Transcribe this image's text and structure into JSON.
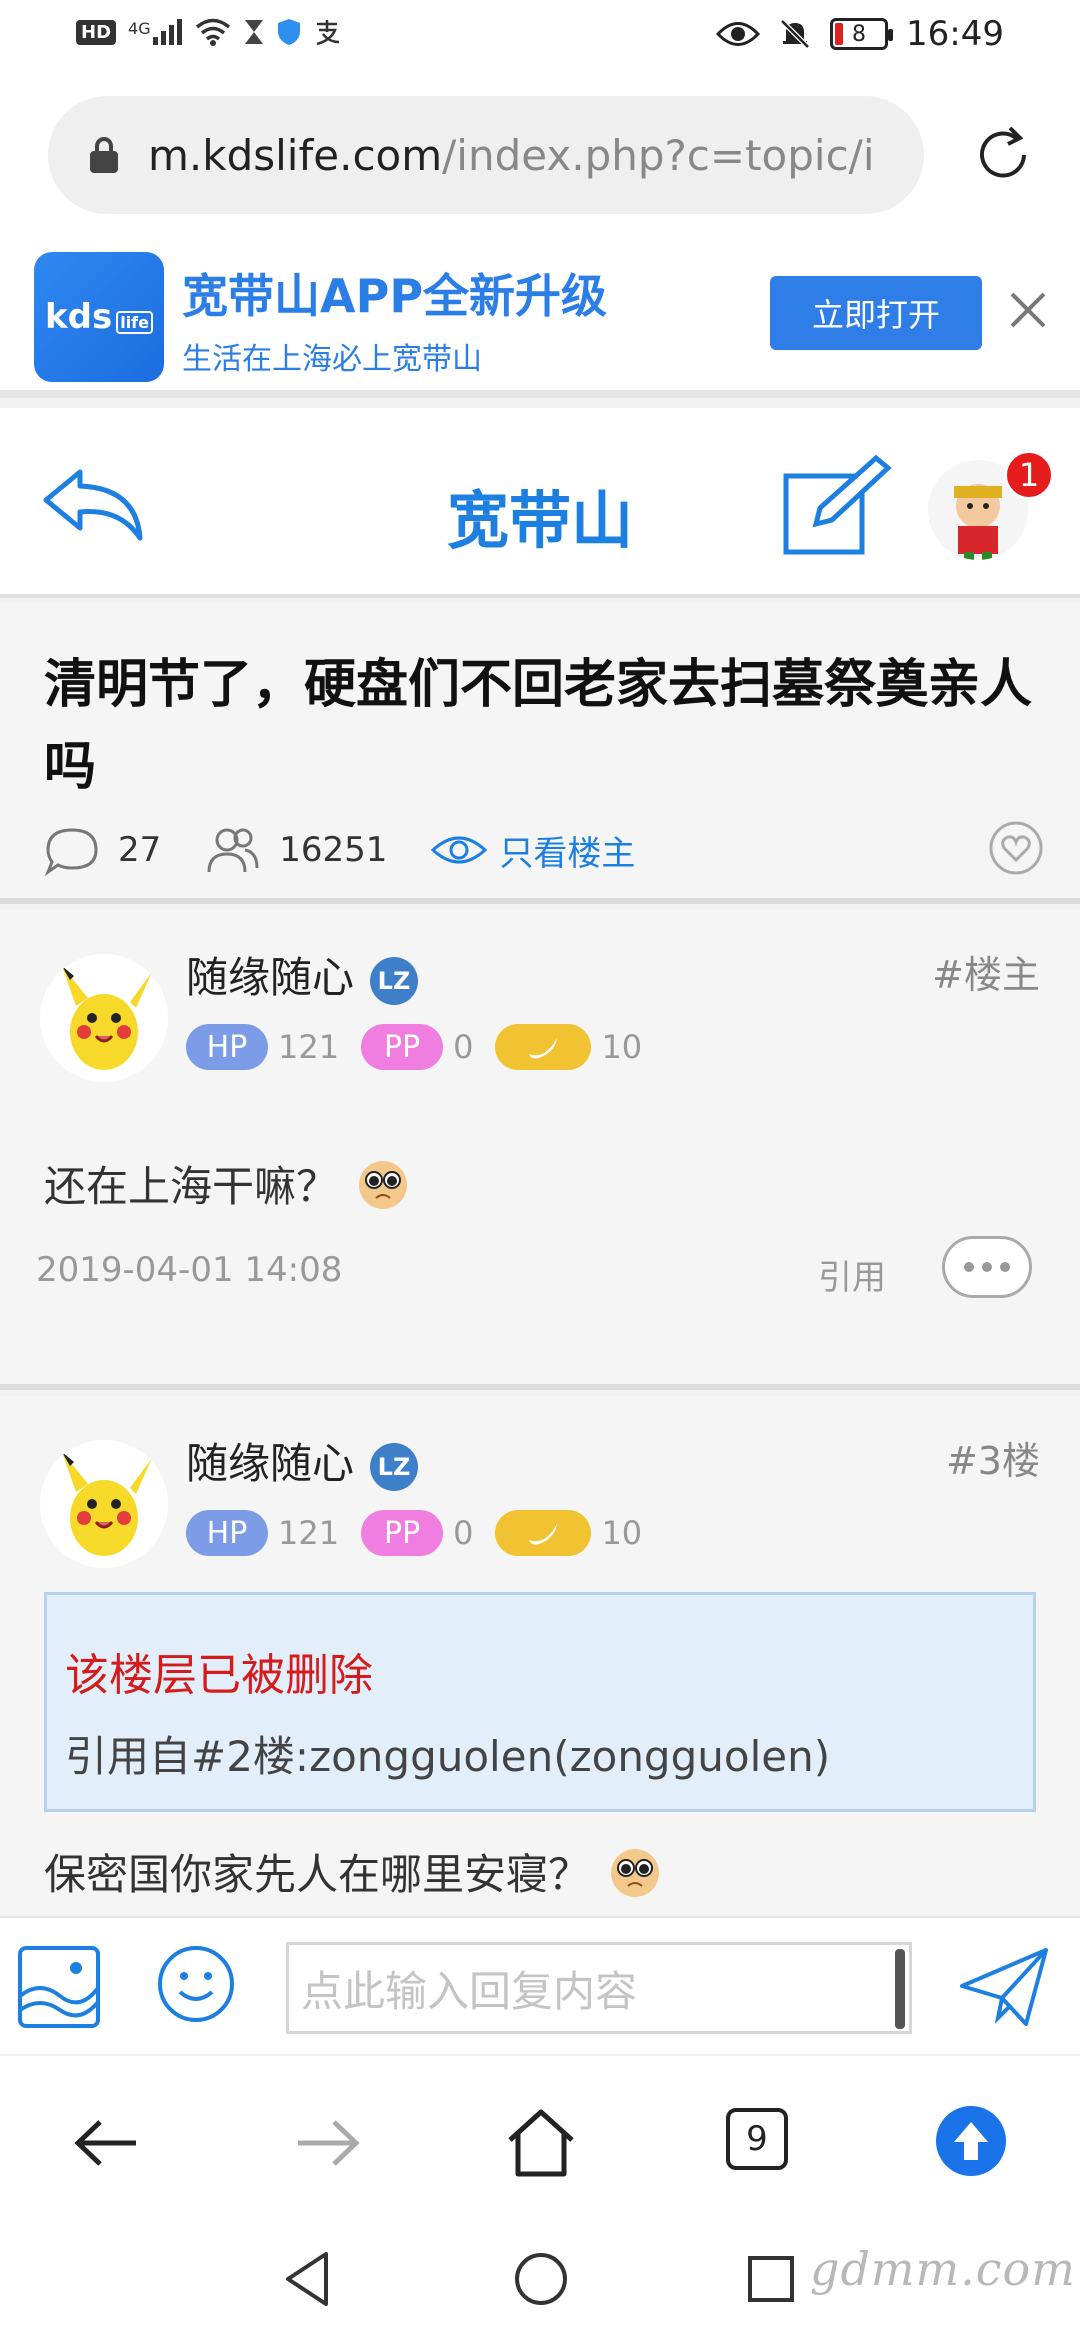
{
  "status_bar": {
    "left_icons": [
      "hd-badge",
      "signal-4g-icon",
      "wifi-icon",
      "hourglass-icon",
      "shield-icon",
      "alipay-icon"
    ],
    "network": "4G",
    "hd": "HD",
    "battery": "8",
    "time": "16:49"
  },
  "address_bar": {
    "url_host": "m.kdslife.com",
    "url_rest": "/index.php?c=topic/i"
  },
  "app_banner": {
    "logo_text": "kds",
    "logo_small": "life",
    "title": "宽带山APP全新升级",
    "subtitle": "生活在上海必上宽带山",
    "open_label": "立即打开"
  },
  "site_header": {
    "title": "宽带山",
    "notification_count": "1"
  },
  "topic": {
    "title": "清明节了，硬盘们不回老家去扫墓祭奠亲人吗",
    "replies": "27",
    "views": "16251",
    "only_op_label": "只看楼主"
  },
  "posts": [
    {
      "username": "随缘随心",
      "lz": "LZ",
      "floor": "#楼主",
      "hp_label": "HP",
      "hp": "121",
      "pp_label": "PP",
      "pp": "0",
      "banana": "10",
      "content": "还在上海干嘛？",
      "time": "2019-04-01 14:08",
      "quote_label": "引用"
    },
    {
      "username": "随缘随心",
      "lz": "LZ",
      "floor": "#3楼",
      "hp_label": "HP",
      "hp": "121",
      "pp_label": "PP",
      "pp": "0",
      "banana": "10",
      "deleted_notice": "该楼层已被删除",
      "quote_source": "引用自#2楼:zongguolen(zongguolen)",
      "content": "保密国你家先人在哪里安寝？"
    }
  ],
  "reply_bar": {
    "placeholder": "点此输入回复内容"
  },
  "browser_nav": {
    "tabs_count": "9"
  },
  "watermark": "gdmm.com",
  "colors": {
    "brand_blue": "#1d7fe0",
    "banner_button": "#2f7ee8",
    "notification_red": "#e41c1c",
    "deleted_red": "#d41c1c",
    "quote_bg": "#e3eefb",
    "hp_badge": "#7d9ce8",
    "pp_badge": "#f07ee0",
    "banana_badge": "#f1c332"
  }
}
